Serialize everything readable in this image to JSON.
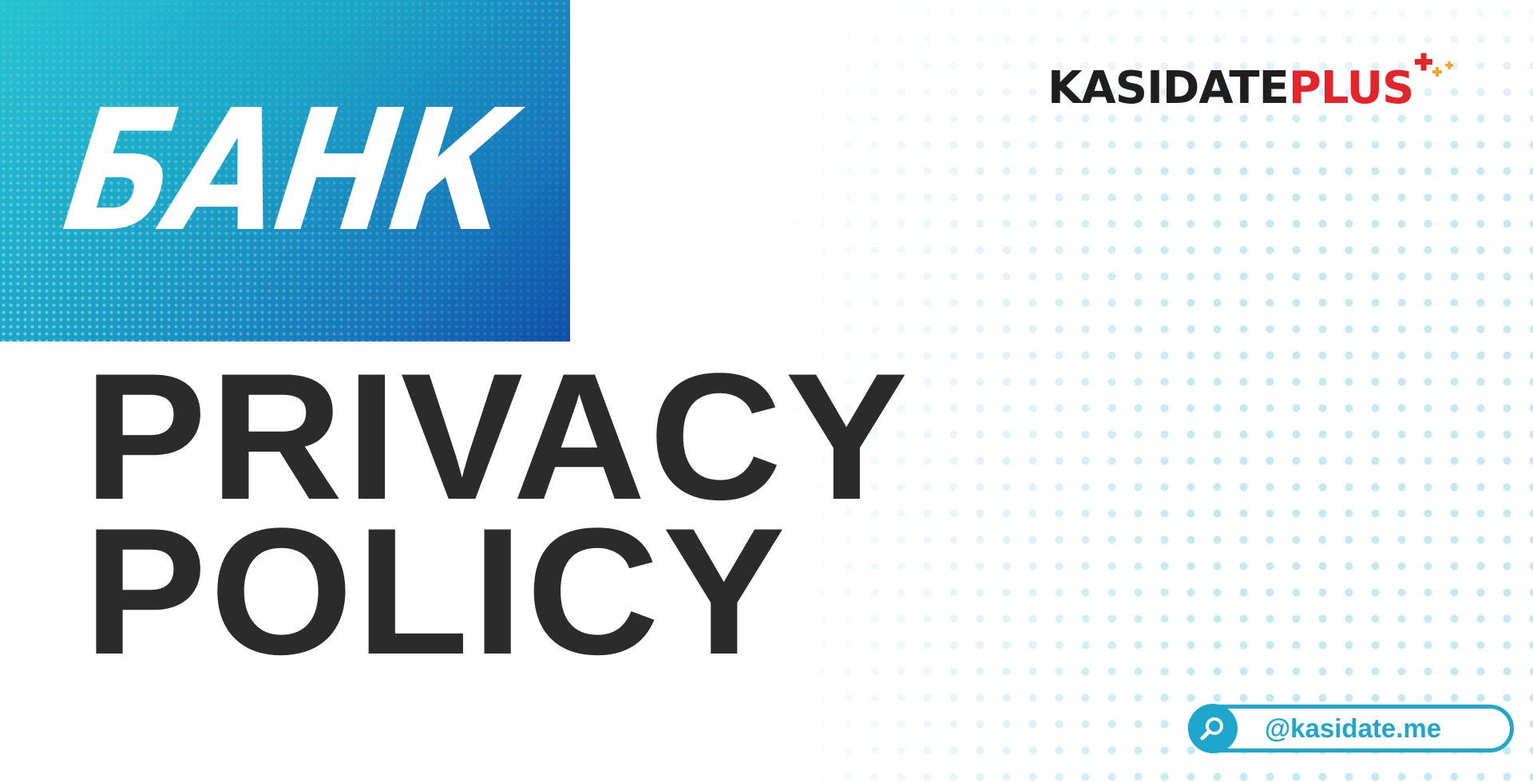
{
  "banner": {
    "title": "БАНК"
  },
  "logo": {
    "main_text": "KASIDATE",
    "accent_text": "PLUS",
    "icon": "plus-crosses-icon"
  },
  "headline": {
    "line1": "PRIVACY",
    "line2": "POLICY"
  },
  "handle": {
    "icon": "search-icon",
    "text": "@kasidate.me"
  },
  "colors": {
    "headline": "#2b2b2b",
    "accent_red": "#e52429",
    "accent_blue": "#1ea7cc",
    "banner_start": "#27c3d2",
    "banner_end": "#0f4fa8",
    "dots": "#bfe9f0"
  }
}
